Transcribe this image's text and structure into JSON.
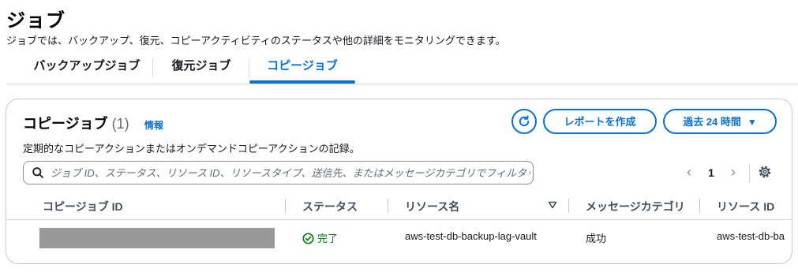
{
  "page": {
    "title": "ジョブ",
    "description": "ジョブでは、バックアップ、復元、コピーアクティビティのステータスや他の詳細をモニタリングできます。"
  },
  "tabs": [
    {
      "label": "バックアップジョブ",
      "active": false
    },
    {
      "label": "復元ジョブ",
      "active": false
    },
    {
      "label": "コピージョブ",
      "active": true
    }
  ],
  "panel": {
    "title": "コピージョブ",
    "count": "(1)",
    "info_link": "情報",
    "description": "定期的なコピーアクションまたはオンデマンドコピーアクションの記録。",
    "report_button": "レポートを作成",
    "time_range_button": "過去 24 時間",
    "search_placeholder": "ジョブ ID、ステータス、リソース ID、リソースタイプ、送信先、またはメッセージカテゴリでフィルタリング",
    "current_page": "1",
    "columns": [
      "コピージョブ ID",
      "ステータス",
      "リソース名",
      "メッセージカテゴリ",
      "リソース ID"
    ],
    "rows": [
      {
        "copy_job_id": "",
        "status": "完了",
        "resource_name": "aws-test-db-backup-lag-vault",
        "message_category": "成功",
        "resource_id": "aws-test-db-ba"
      }
    ]
  },
  "colors": {
    "accent": "#0972d3",
    "success": "#037f0c",
    "redaction": "#999999"
  },
  "icons": [
    "refresh-icon",
    "caret-down-icon",
    "search-icon",
    "chevron-left-icon",
    "chevron-right-icon",
    "settings-icon",
    "sort-desc-icon",
    "success-check-icon"
  ]
}
